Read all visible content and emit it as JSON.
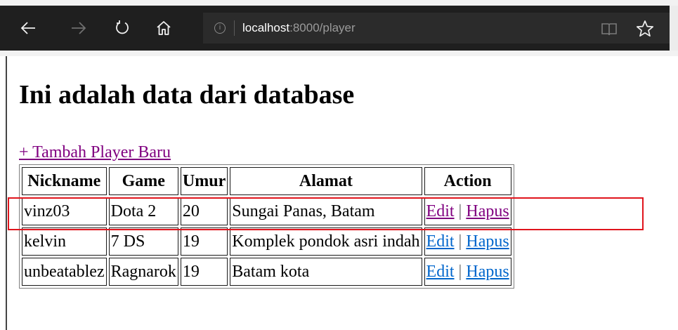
{
  "browser": {
    "url_host": "localhost",
    "url_path": ":8000/player"
  },
  "page": {
    "title": "Ini adalah data dari database",
    "add_link": "+ Tambah Player Baru"
  },
  "table": {
    "headers": [
      "Nickname",
      "Game",
      "Umur",
      "Alamat",
      "Action"
    ],
    "rows": [
      {
        "nickname": "vinz03",
        "game": "Dota 2",
        "umur": "20",
        "alamat": "Sungai Panas, Batam",
        "visited": true
      },
      {
        "nickname": "kelvin",
        "game": "7 DS",
        "umur": "19",
        "alamat": "Komplek pondok asri indah",
        "visited": false
      },
      {
        "nickname": "unbeatablez",
        "game": "Ragnarok",
        "umur": "19",
        "alamat": "Batam kota",
        "visited": false
      }
    ],
    "edit_label": "Edit",
    "separator": "|",
    "delete_label": "Hapus"
  },
  "colors": {
    "visited_link": "#800080",
    "unvisited_link": "#0066cc",
    "highlight_box": "#e0141c"
  },
  "icons": [
    "back-arrow-icon",
    "forward-arrow-icon",
    "refresh-icon",
    "home-icon",
    "info-icon",
    "reading-view-icon",
    "favorite-star-icon"
  ]
}
